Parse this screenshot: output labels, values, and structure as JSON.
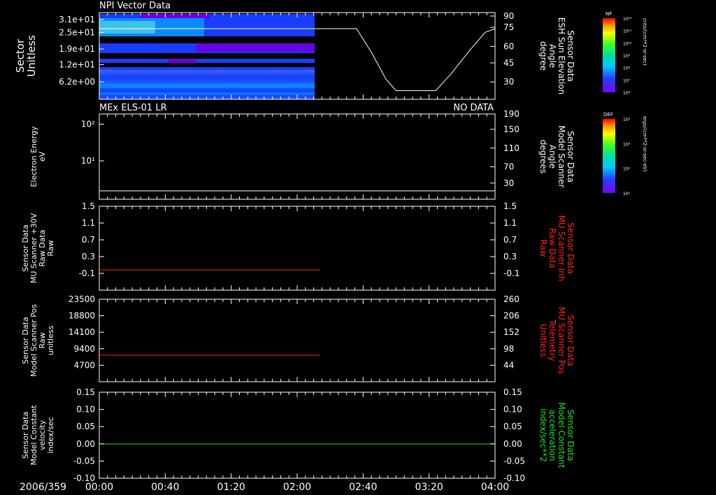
{
  "date_label": "2006/359",
  "time_ticks": [
    "00:00",
    "00:40",
    "01:20",
    "02:00",
    "02:40",
    "03:20",
    "04:00"
  ],
  "time_range_hours": [
    0,
    4
  ],
  "data_end_hours": 2.2,
  "panels": [
    {
      "id": "npi",
      "title": "NPI Vector Data",
      "status": "",
      "left_label": [
        "Sector",
        "Unitless"
      ],
      "left_ticks": [
        "3.1e+01",
        "2.5e+01",
        "1.9e+01",
        "1.2e+01",
        "6.2e+00"
      ],
      "right_label": [
        "Sensor Data",
        "ESH Sun Elevation",
        "Angle",
        "degree"
      ],
      "right_label_color": "#ffffff",
      "right_ticks": [
        "90",
        "75",
        "60",
        "45",
        "30"
      ]
    },
    {
      "id": "els",
      "title": "MEx ELS-01 LR",
      "status": "NO DATA",
      "left_label": [
        "Electron Energy",
        "eV"
      ],
      "left_ticks": [
        "10²",
        "10¹"
      ],
      "right_label": [
        "Sensor Data",
        "Model Scanner",
        "Angle",
        "degrees"
      ],
      "right_label_color": "#ffffff",
      "right_ticks": [
        "190",
        "150",
        "110",
        "70",
        "30"
      ]
    },
    {
      "id": "mu-inh",
      "title": "",
      "status": "",
      "left_label": [
        "Sensor Data",
        "MU Scanner +30V",
        "Raw Data",
        "Raw"
      ],
      "left_ticks": [
        "1.5",
        "1.1",
        "0.7",
        "0.3",
        "-0.1"
      ],
      "right_label": [
        "Sensor Data",
        "MU Scanner Inh",
        "Raw Data",
        "Raw"
      ],
      "right_label_color": "#ff2020",
      "right_ticks": [
        "1.5",
        "1.1",
        "0.7",
        "0.3",
        "-0.1"
      ]
    },
    {
      "id": "mu-pos",
      "title": "",
      "status": "",
      "left_label": [
        "Sensor Data",
        "Model Scanner Pos",
        "Raw",
        "unitless"
      ],
      "left_ticks": [
        "23500",
        "18800",
        "14100",
        "9400",
        "4700"
      ],
      "right_label": [
        "Sensor Data",
        "MU Scanner Pos",
        "Telemetry",
        "Unitless"
      ],
      "right_label_color": "#ff2020",
      "right_ticks": [
        "260",
        "206",
        "152",
        "98",
        "44"
      ]
    },
    {
      "id": "model-const",
      "title": "",
      "status": "",
      "left_label": [
        "Sensor Data",
        "Model Constant",
        "velocity",
        "index/sec"
      ],
      "left_ticks": [
        "0.15",
        "0.10",
        "0.05",
        "0.00",
        "-0.05",
        "-0.10"
      ],
      "right_label": [
        "Sensor Data",
        "Model Constant",
        "acceleration",
        "index/sec**2"
      ],
      "right_label_color": "#20e020",
      "right_ticks": [
        "0.15",
        "0.10",
        "0.05",
        "0.00",
        "-0.05",
        "-0.10"
      ]
    }
  ],
  "colorbars": [
    {
      "tag": "NF",
      "unit": "cnts/(cm**2-sr-sec)",
      "labels": [
        "10¹²",
        "10¹¹",
        "10¹⁰",
        "10⁹",
        "10⁸",
        "10⁷",
        "10⁶"
      ]
    },
    {
      "tag": "DEF",
      "unit": "ergs/(cm**2-sr-sec-eV)",
      "labels": [
        "10⁴",
        "10³",
        "10²",
        "10¹"
      ]
    }
  ],
  "chart_data": [
    {
      "type": "heatmap",
      "title": "NPI Vector Data",
      "ylabel": "Sector Unitless",
      "y_ticks": [
        31,
        25,
        19,
        12,
        6.2
      ],
      "x_range": [
        "00:00",
        "04:00"
      ],
      "data_until": "02:12",
      "overlay_line": {
        "name": "ESH Sun Elevation Angle",
        "unit": "degree",
        "points": [
          [
            0,
            79
          ],
          [
            2.3,
            79
          ],
          [
            2.6,
            79
          ],
          [
            2.75,
            60
          ],
          [
            2.9,
            38
          ],
          [
            3.0,
            29
          ],
          [
            3.4,
            29
          ],
          [
            3.55,
            42
          ],
          [
            3.75,
            62
          ],
          [
            3.9,
            76
          ],
          [
            4.0,
            79
          ]
        ]
      }
    },
    {
      "type": "line",
      "title": "MEx ELS-01 LR",
      "status": "NO DATA",
      "ylabel": "Electron Energy eV",
      "series": [
        {
          "name": "Model Scanner Angle",
          "axis": "right",
          "values": [
            [
              0,
              5
            ],
            [
              4,
              5
            ]
          ]
        }
      ],
      "right_ylim": [
        5,
        190
      ]
    },
    {
      "type": "line",
      "ylim": [
        -0.3,
        1.5
      ],
      "series": [
        {
          "name": "MU Scanner Inh Raw",
          "color": "#ff2020",
          "values": [
            [
              0,
              0
            ],
            [
              2.2,
              0
            ]
          ]
        }
      ]
    },
    {
      "type": "line",
      "ylim": [
        0,
        23500
      ],
      "series": [
        {
          "name": "MU Scanner Pos",
          "color": "#ff2020",
          "values": [
            [
              0,
              8000
            ],
            [
              2.2,
              8000
            ]
          ]
        }
      ]
    },
    {
      "type": "line",
      "ylim": [
        -0.1,
        0.15
      ],
      "series": [
        {
          "name": "Model Constant",
          "color": "#20e020",
          "values": [
            [
              0,
              0
            ],
            [
              4,
              0
            ]
          ]
        }
      ]
    }
  ]
}
